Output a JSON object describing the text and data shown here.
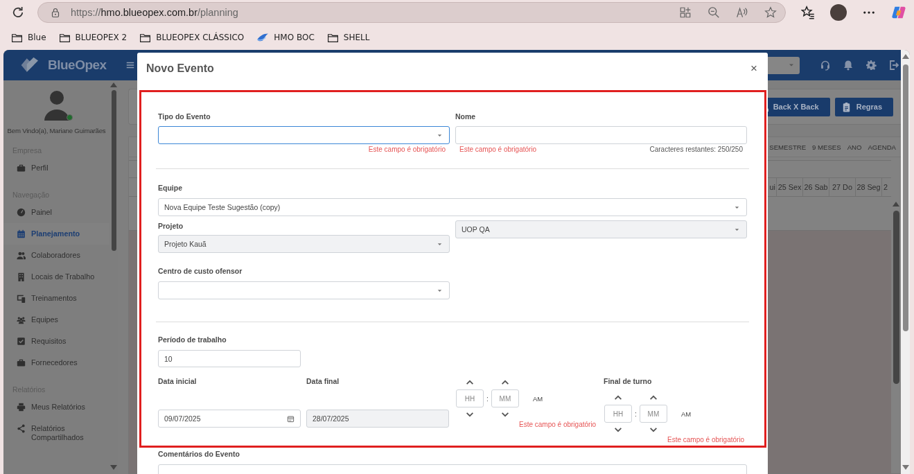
{
  "browser": {
    "url": {
      "scheme": "https://",
      "host": "hmo.blueopex.com.br",
      "path": "/planning"
    },
    "bookmarks": [
      {
        "label": "Blue",
        "kind": "folder"
      },
      {
        "label": "BLUEOPEX 2",
        "kind": "folder"
      },
      {
        "label": "BLUEOPEX CLÁSSICO",
        "kind": "folder"
      },
      {
        "label": "HMO BOC",
        "kind": "site"
      },
      {
        "label": "SHELL",
        "kind": "folder"
      }
    ]
  },
  "app": {
    "logo": "BlueOpex",
    "user": {
      "welcome": "Bem Vindo(a), Mariane Guimarães",
      "online": true
    },
    "sidebar": {
      "sections": [
        {
          "heading": "Empresa",
          "items": [
            {
              "label": "Perfil",
              "selected": false
            }
          ]
        },
        {
          "heading": "Navegação",
          "items": [
            {
              "label": "Painel",
              "selected": false
            },
            {
              "label": "Planejamento",
              "selected": true
            },
            {
              "label": "Colaboradores",
              "selected": false
            },
            {
              "label": "Locais de Trabalho",
              "selected": false
            },
            {
              "label": "Treinamentos",
              "selected": false
            },
            {
              "label": "Equipes",
              "selected": false
            },
            {
              "label": "Requisitos",
              "selected": false
            },
            {
              "label": "Fornecedores",
              "selected": false
            }
          ]
        },
        {
          "heading": "Relatórios",
          "items": [
            {
              "label": "Meus Relatórios",
              "selected": false
            },
            {
              "label": "Relatórios Compartilhados",
              "selected": false
            }
          ]
        }
      ]
    },
    "toolbar_buttons": [
      "Back X Back",
      "Regras"
    ],
    "view_tabs": [
      {
        "label": "SEMESTRE",
        "selected": false
      },
      {
        "label": "9 MESES",
        "selected": false
      },
      {
        "label": "ANO",
        "selected": false
      },
      {
        "label": "AGENDA",
        "selected": false
      }
    ],
    "calendar_days": [
      "ui",
      "25 Sex",
      "26 Sab",
      "27 Do",
      "28 Seg",
      "2"
    ]
  },
  "modal": {
    "title": "Novo Evento",
    "close_label": "×",
    "event_type": {
      "label": "Tipo do Evento",
      "focused": true,
      "disabled": false,
      "error": "Este campo é obrigatório"
    },
    "name": {
      "label": "Nome",
      "focused": false,
      "disabled": false,
      "error": "Este campo é obrigatório",
      "counter": "Caracteres restantes: 250/250"
    },
    "team": {
      "label": "Equipe",
      "value": "Nova Equipe Teste Sugestão (copy)",
      "focused": false,
      "disabled": false
    },
    "project": {
      "label": "Projeto",
      "value": "Projeto Kauã",
      "focused": false,
      "disabled": true
    },
    "unit": {
      "value": "UOP QA",
      "focused": false,
      "disabled": true
    },
    "cost_center": {
      "label": "Centro de custo ofensor",
      "focused": false,
      "disabled": false
    },
    "work_period": {
      "label": "Período de trabalho",
      "value": "10"
    },
    "start_date": {
      "label": "Data inicial",
      "value": "09/07/2025",
      "disabled": false
    },
    "end_date": {
      "label": "Data final",
      "value": "28/07/2025",
      "disabled": true
    },
    "shift_start": {
      "hours_placeholder": "HH",
      "separator": ":",
      "minutes_placeholder": "MM",
      "meridiem": "AM",
      "error": "Este campo é obrigatório"
    },
    "shift_end": {
      "label": "Final de turno",
      "hours_placeholder": "HH",
      "separator": ":",
      "minutes_placeholder": "MM",
      "meridiem": "AM",
      "error": "Este campo é obrigatório"
    },
    "comments": {
      "label": "Comentários do Evento"
    }
  }
}
